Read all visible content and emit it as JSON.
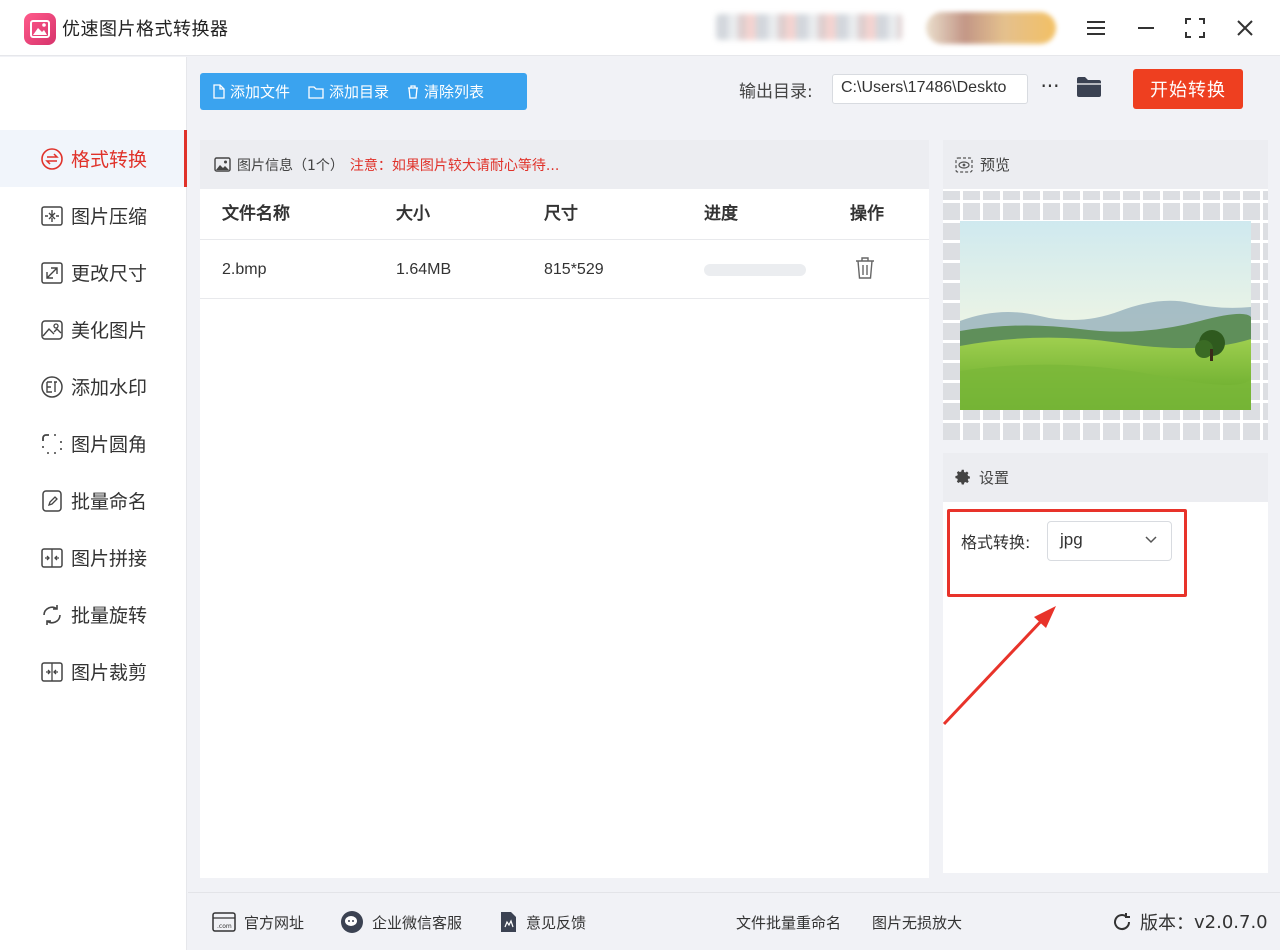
{
  "app": {
    "title": "优速图片格式转换器"
  },
  "window": {
    "menu_icon": "menu-icon",
    "minimize_icon": "minimize-icon",
    "maximize_icon": "maximize-icon",
    "close_icon": "close-icon"
  },
  "sidebar": {
    "items": [
      {
        "label": "格式转换",
        "icon": "convert-icon",
        "active": true
      },
      {
        "label": "图片压缩",
        "icon": "compress-icon"
      },
      {
        "label": "更改尺寸",
        "icon": "resize-icon"
      },
      {
        "label": "美化图片",
        "icon": "beautify-icon"
      },
      {
        "label": "添加水印",
        "icon": "watermark-icon"
      },
      {
        "label": "图片圆角",
        "icon": "round-corner-icon"
      },
      {
        "label": "批量命名",
        "icon": "rename-icon"
      },
      {
        "label": "图片拼接",
        "icon": "join-icon"
      },
      {
        "label": "批量旋转",
        "icon": "rotate-icon"
      },
      {
        "label": "图片裁剪",
        "icon": "crop-icon"
      }
    ]
  },
  "toolbar": {
    "add_file": "添加文件",
    "add_folder": "添加目录",
    "clear_list": "清除列表",
    "output_label": "输出目录:",
    "output_path": "C:\\Users\\17486\\Deskto",
    "more": "···",
    "start": "开始转换"
  },
  "file_panel": {
    "header": "图片信息（1个）",
    "notice": "注意：如果图片较大请耐心等待...",
    "columns": [
      "文件名称",
      "大小",
      "尺寸",
      "进度",
      "操作"
    ],
    "rows": [
      {
        "name": "2.bmp",
        "size": "1.64MB",
        "dimensions": "815*529",
        "progress": 0
      }
    ]
  },
  "preview": {
    "title": "预览"
  },
  "settings": {
    "title": "设置",
    "format_label": "格式转换:",
    "format_value": "jpg"
  },
  "footer": {
    "website": "官方网址",
    "wechat": "企业微信客服",
    "feedback": "意见反馈",
    "batch_rename": "文件批量重命名",
    "lossless_enlarge": "图片无损放大",
    "version_label": "版本：",
    "version": "v2.0.7.0"
  },
  "colors": {
    "accent_red": "#ee3f20",
    "toolbar_blue": "#3aa3ef",
    "highlight": "#e8332a"
  }
}
